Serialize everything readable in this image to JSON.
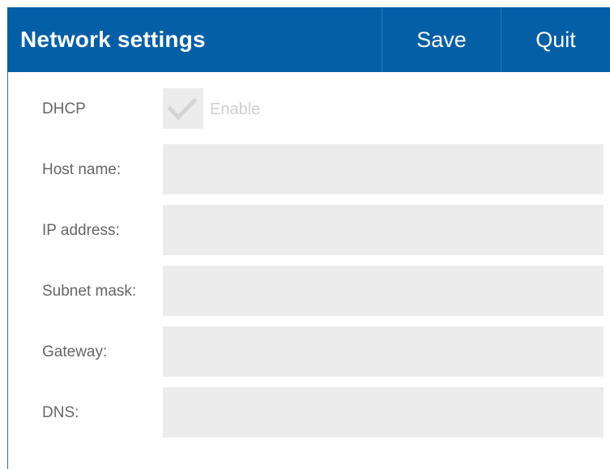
{
  "header": {
    "title": "Network settings",
    "save_label": "Save",
    "quit_label": "Quit"
  },
  "colors": {
    "header_bg": "#055fa7",
    "field_bg": "#ececec",
    "label_text": "#666666",
    "disabled_text": "#d0d0d0"
  },
  "form": {
    "dhcp": {
      "label": "DHCP",
      "checkbox_label": "Enable",
      "checked": true,
      "icon": "check-icon"
    },
    "host_name": {
      "label": "Host name:",
      "value": ""
    },
    "ip_address": {
      "label": "IP address:",
      "value": ""
    },
    "subnet_mask": {
      "label": "Subnet mask:",
      "value": ""
    },
    "gateway": {
      "label": "Gateway:",
      "value": ""
    },
    "dns": {
      "label": "DNS:",
      "value": ""
    }
  }
}
